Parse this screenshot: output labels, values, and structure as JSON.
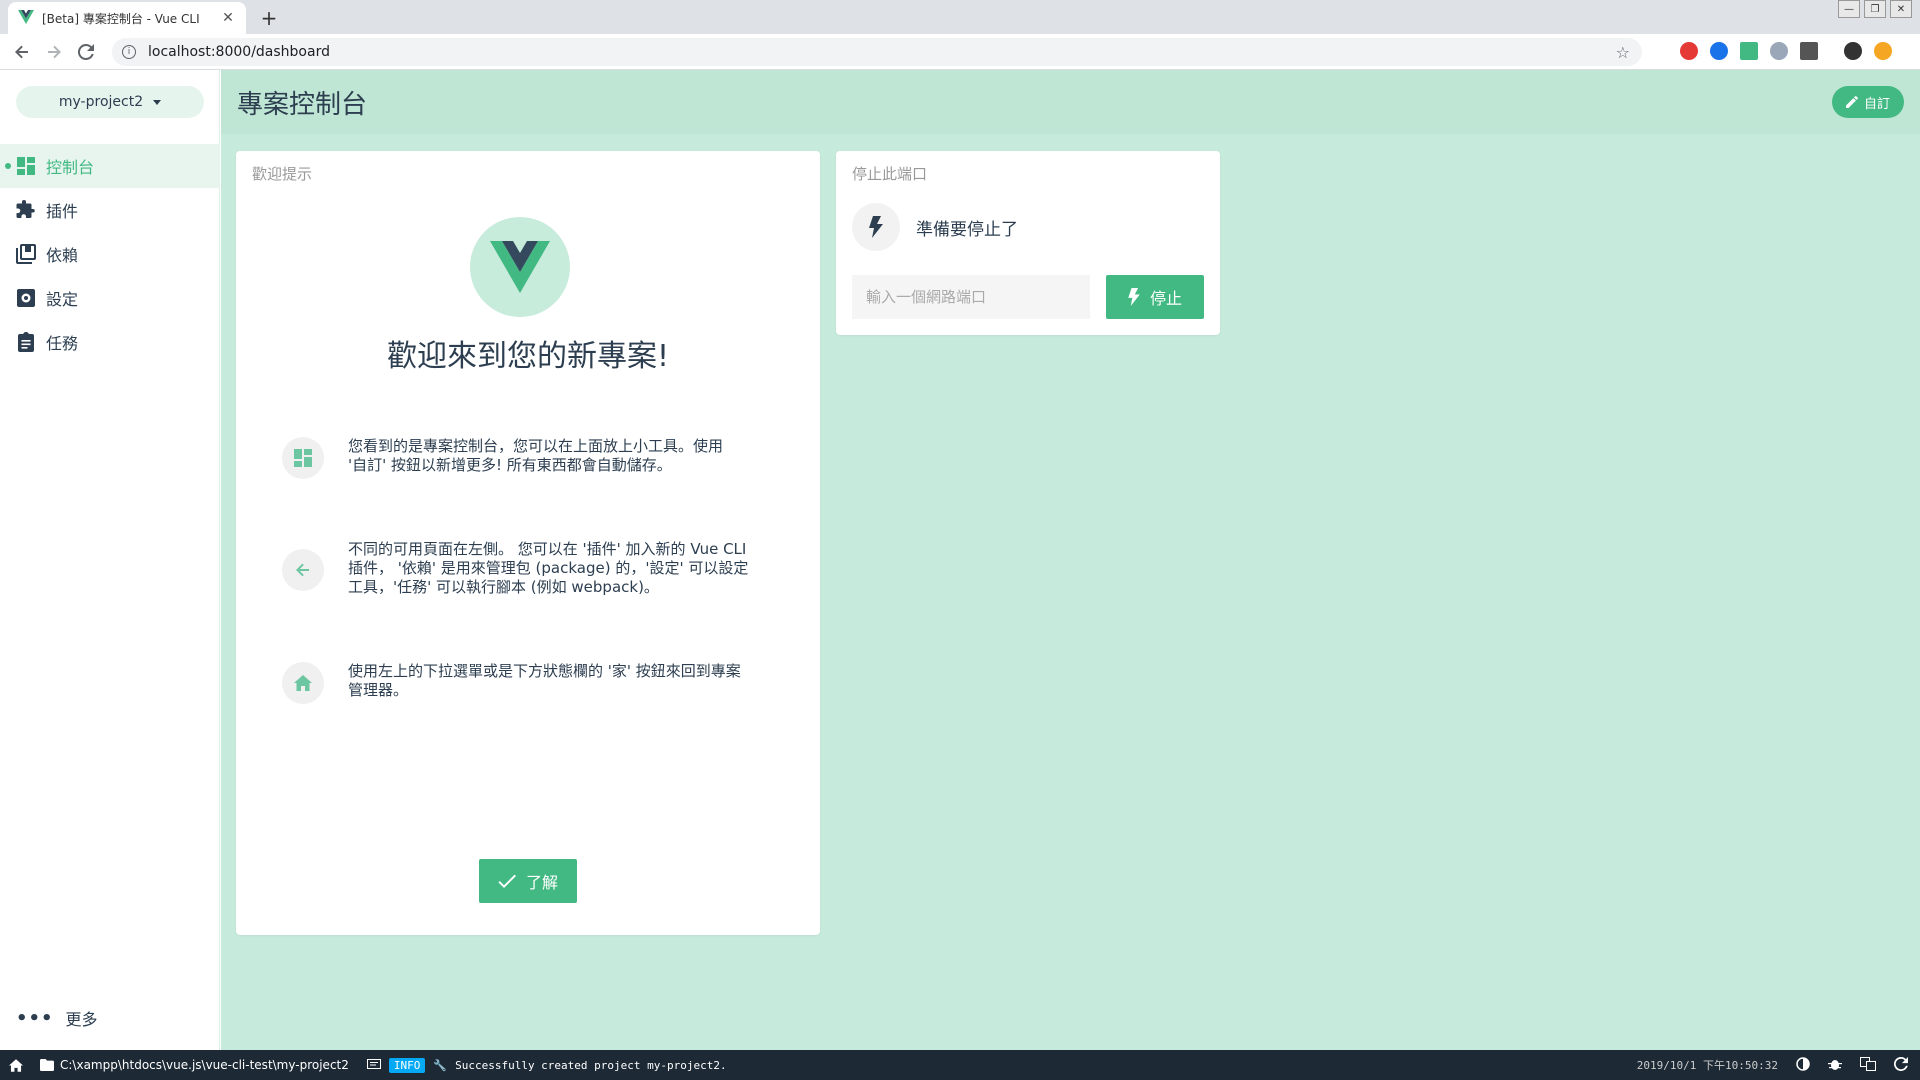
{
  "browser": {
    "tab_title": "[Beta] 專案控制台 - Vue CLI",
    "url": "localhost:8000/dashboard"
  },
  "sidebar": {
    "project": "my-project2",
    "items": [
      {
        "label": "控制台"
      },
      {
        "label": "插件"
      },
      {
        "label": "依賴"
      },
      {
        "label": "設定"
      },
      {
        "label": "任務"
      }
    ],
    "more": "更多"
  },
  "header": {
    "title": "專案控制台",
    "customize": "自訂"
  },
  "welcome": {
    "card_title": "歡迎提示",
    "heading": "歡迎來到您的新專案!",
    "tips": [
      {
        "line1": "您看到的是專案控制台，您可以在上面放上小工具。使用",
        "line2": "'自訂' 按鈕以新增更多! 所有東西都會自動儲存。"
      },
      {
        "line1": "不同的可用頁面在左側。 您可以在 '插件' 加入新的 Vue CLI",
        "line2": "插件， '依賴' 是用來管理包 (package) 的，'設定' 可以設定",
        "line3": "工具，'任務' 可以執行腳本 (例如 webpack)。"
      },
      {
        "line1": "使用左上的下拉選單或是下方狀態欄的 '家' 按鈕來回到專案",
        "line2": "管理器。"
      }
    ],
    "ok": "了解"
  },
  "kill_port": {
    "card_title": "停止此端口",
    "message": "準備要停止了",
    "placeholder": "輸入一個網路端口",
    "button": "停止"
  },
  "statusbar": {
    "path": "C:\\xampp\\htdocs\\vue.js\\vue-cli-test\\my-project2",
    "badge": "INFO",
    "message": "Successfully created project my-project2.",
    "time": "2019/10/1 下午10:50:32"
  },
  "colors": {
    "accent": "#42b983",
    "main_bg": "#c6eadb",
    "statusbar_bg": "#1d2935"
  }
}
